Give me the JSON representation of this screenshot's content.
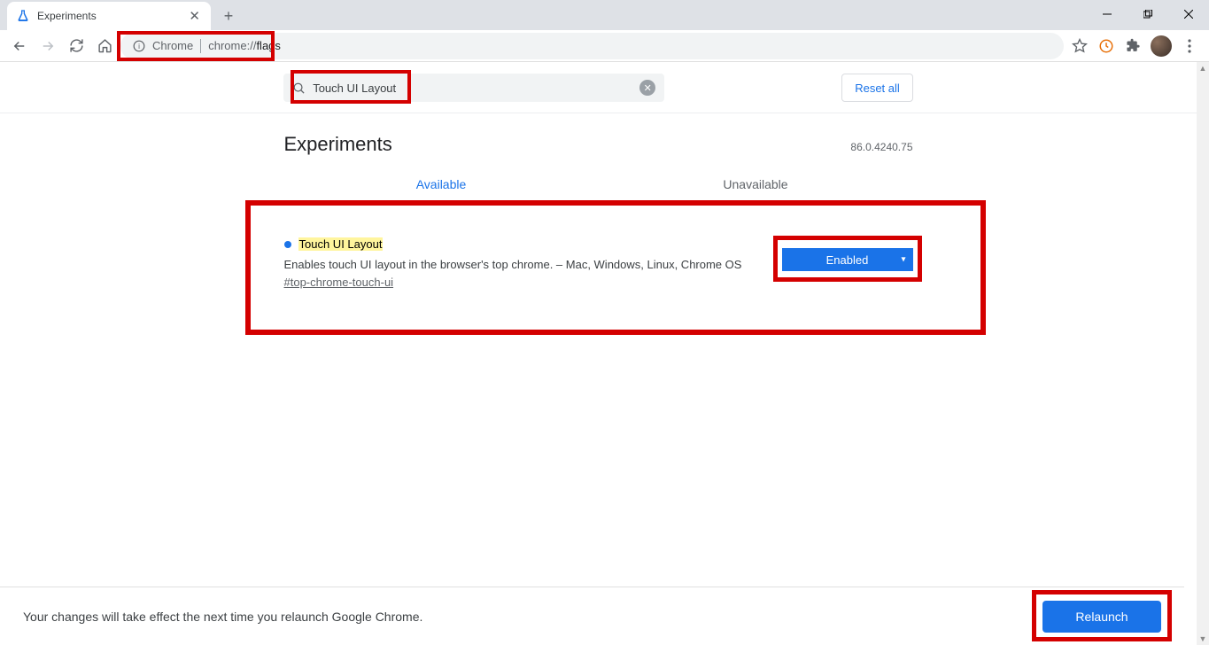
{
  "tab": {
    "title": "Experiments"
  },
  "omnibox": {
    "badge": "Chrome",
    "url_proto": "chrome://",
    "url_path": "flags"
  },
  "search": {
    "value": "Touch UI Layout"
  },
  "reset_label": "Reset all",
  "heading": "Experiments",
  "version": "86.0.4240.75",
  "tabs": {
    "available": "Available",
    "unavailable": "Unavailable"
  },
  "flag": {
    "title": "Touch UI Layout",
    "desc": "Enables touch UI layout in the browser's top chrome. – Mac, Windows, Linux, Chrome OS",
    "anchor": "#top-chrome-touch-ui",
    "selected": "Enabled"
  },
  "footer": {
    "message": "Your changes will take effect the next time you relaunch Google Chrome.",
    "relaunch": "Relaunch"
  }
}
